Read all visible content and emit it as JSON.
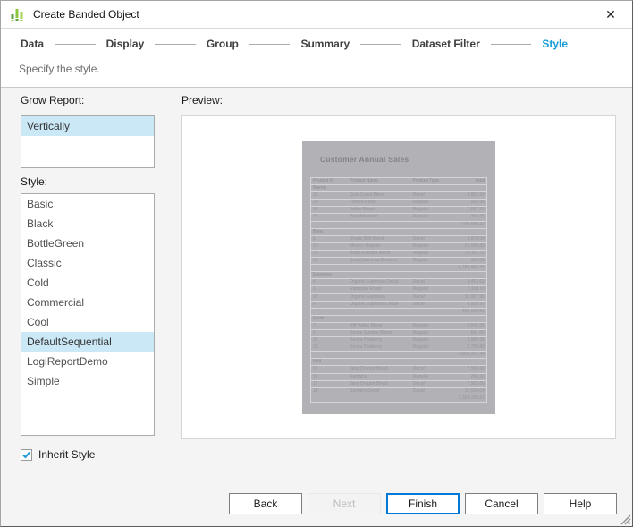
{
  "window": {
    "title": "Create Banded Object",
    "close_glyph": "✕"
  },
  "steps": {
    "items": [
      {
        "label": "Data",
        "active": false
      },
      {
        "label": "Display",
        "active": false
      },
      {
        "label": "Group",
        "active": false
      },
      {
        "label": "Summary",
        "active": false
      },
      {
        "label": "Dataset Filter",
        "active": false
      },
      {
        "label": "Style",
        "active": true
      }
    ]
  },
  "subtitle": "Specify the style.",
  "grow_report": {
    "label": "Grow Report:",
    "options": [
      "Vertically"
    ],
    "selected": "Vertically"
  },
  "style_list": {
    "label": "Style:",
    "options": [
      "Basic",
      "Black",
      "BottleGreen",
      "Classic",
      "Cold",
      "Commercial",
      "Cool",
      "DefaultSequential",
      "LogiReportDemo",
      "Simple"
    ],
    "selected": "DefaultSequential"
  },
  "preview": {
    "label": "Preview:",
    "report": {
      "title": "Customer Annual Sales",
      "columns": [
        "Product ID",
        "Product Name",
        "Product Type",
        "Total"
      ],
      "groups": [
        {
          "name": "Blends",
          "rows": [
            [
              "21",
              "Gold Coast Blend",
              "Decaf",
              "9,852.69"
            ],
            [
              "23",
              "French Roast",
              "Regular",
              "583.96"
            ],
            [
              "24",
              "Italian Roast",
              "Regular",
              "7,267.20"
            ],
            [
              "26",
              "Blue Mountain",
              "Regular",
              "355.65"
            ]
          ],
          "total": "1,029,908.42"
        },
        {
          "name": "Brew",
          "rows": [
            [
              "5",
              "Shade Bell Blend",
              "Decaf",
              "2,878.09"
            ],
            [
              "10",
              "Mexico Organic",
              "Regular",
              "21,036.83"
            ],
            [
              "13",
              "Brazil Estrada Blend",
              "Regular",
              "74,161.70"
            ],
            [
              "13",
              "Brazil Ipanema Bourbon",
              "Regular",
              "384.61"
            ]
          ],
          "total": "4,789,842.31"
        },
        {
          "name": "Espresso",
          "rows": [
            [
              "4",
              "Organic Espresso Decaf",
              "Decaf",
              "3,452.62"
            ],
            [
              "1",
              "Espresso Roast",
              "Regular",
              "7,110.10"
            ],
            [
              "22",
              "Organic Espresso",
              "Decaf",
              "16,907.90"
            ],
            [
              "6",
              "Organic Espresso Decaf",
              "Decaf",
              "8,559.97"
            ]
          ],
          "total": "450,654.61"
        },
        {
          "name": "Exotic",
          "rows": [
            [
              "7",
              "Rift Valley Blend",
              "Regular",
              "6,542.05"
            ],
            [
              "5",
              "Kenya Sunrise Blend",
              "Regular",
              "691.60"
            ],
            [
              "21",
              "Kenya Peaberry",
              "Regular",
              "3,585.95"
            ],
            [
              "29",
              "Kenya Peaberry",
              "Regular",
              "2,799.89"
            ]
          ],
          "total": "2,856,971.46"
        },
        {
          "name": "Mild",
          "rows": [
            [
              "17",
              "Java Dragon Blend",
              "Decaf",
              "7,565.60"
            ],
            [
              "19",
              "Sumatra",
              "Regular",
              "266.20"
            ],
            [
              "17",
              "Java Dragon Blend",
              "Decaf",
              "7,565.60"
            ],
            [
              "14",
              "Sumatra Decaf",
              "Decaf",
              "12,094.04"
            ]
          ],
          "total": "2,324,339.61"
        }
      ]
    }
  },
  "inherit_style": {
    "label": "Inherit Style",
    "checked": true
  },
  "buttons": [
    {
      "label": "Back",
      "state": "normal"
    },
    {
      "label": "Next",
      "state": "disabled"
    },
    {
      "label": "Finish",
      "state": "default"
    },
    {
      "label": "Cancel",
      "state": "normal"
    },
    {
      "label": "Help",
      "state": "normal"
    }
  ],
  "colors": {
    "accent_step": "#169bd5",
    "selection": "#cbe8f7",
    "finish_border": "#0078d7",
    "check": "#1f9ad6",
    "icon_green_dark": "#5da344",
    "icon_green_light": "#8cc63f",
    "thumb_bg": "#b2b1b5"
  }
}
